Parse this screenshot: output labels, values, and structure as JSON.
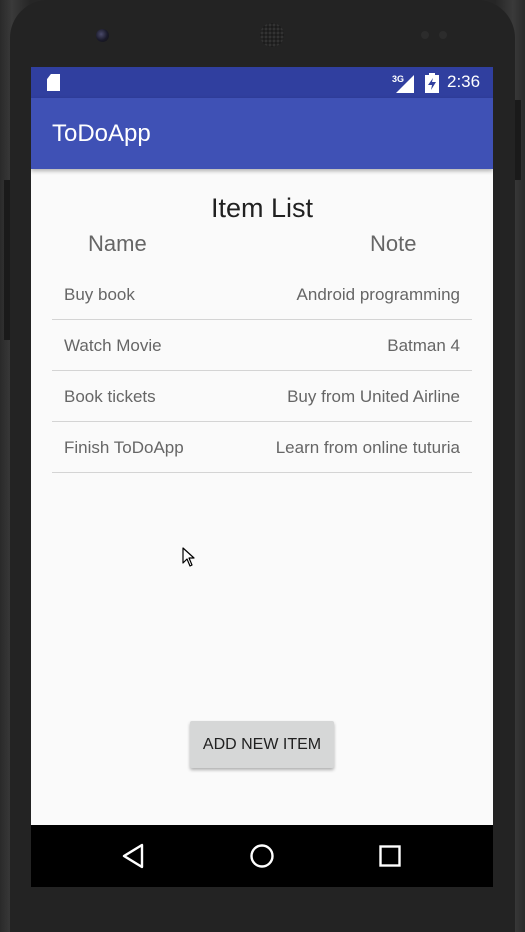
{
  "status_bar": {
    "network": "3G",
    "time": "2:36",
    "icons": [
      "sd-card-icon",
      "signal-icon",
      "battery-charging-icon"
    ]
  },
  "app_bar": {
    "title": "ToDoApp"
  },
  "main": {
    "title": "Item List",
    "columns": {
      "name": "Name",
      "note": "Note"
    },
    "items": [
      {
        "name": "Buy book",
        "note": "Android programming"
      },
      {
        "name": "Watch Movie",
        "note": "Batman 4"
      },
      {
        "name": "Book tickets",
        "note": "Buy from United Airline"
      },
      {
        "name": "Finish ToDoApp",
        "note": "Learn from online tuturia"
      }
    ],
    "add_button_label": "ADD NEW ITEM"
  },
  "nav_bar": {
    "buttons": [
      "back-icon",
      "home-icon",
      "recents-icon"
    ]
  },
  "colors": {
    "primary": "#3f51b5",
    "primary_dark": "#303f9f",
    "background": "#fafafa",
    "button": "#d6d7d7"
  }
}
